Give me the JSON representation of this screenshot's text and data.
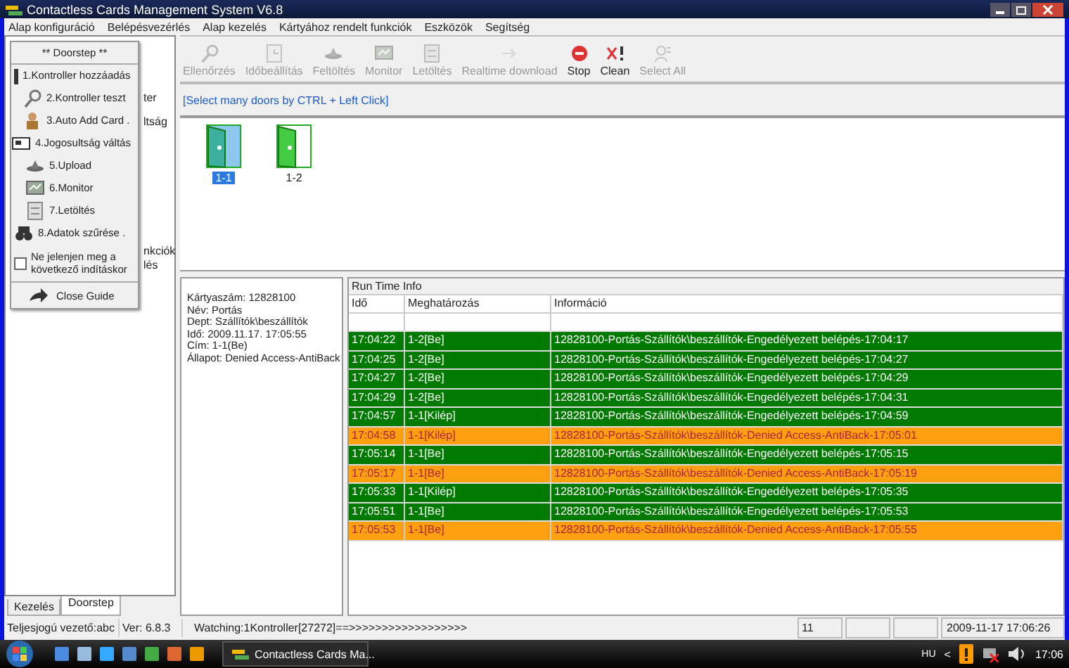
{
  "window": {
    "title": "Contactless Cards Management System  V6.8"
  },
  "menu": [
    "Alap konfiguráció",
    "Belépésvezérlés",
    "Alap kezelés",
    "Kártyához rendelt funkciók",
    "Eszközök",
    "Segítség"
  ],
  "sidebar": {
    "fragments": [
      "ter",
      "ltság",
      "nkciók",
      "lés"
    ],
    "tabs": [
      {
        "label": "Kezelés",
        "selected": false
      },
      {
        "label": "Doorstep",
        "selected": true
      }
    ]
  },
  "guide": {
    "title": "** Doorstep **",
    "items": [
      {
        "label": "1.Kontroller hozzáadás",
        "kind": "add"
      },
      {
        "label": "2.Kontroller teszt",
        "kind": "test"
      },
      {
        "label": "3.Auto Add Card .",
        "kind": "card"
      },
      {
        "label": "4.Jogosultság váltás",
        "kind": "rights"
      },
      {
        "label": "5.Upload",
        "kind": "upload"
      },
      {
        "label": "6.Monitor",
        "kind": "monitor"
      },
      {
        "label": "7.Letöltés",
        "kind": "download"
      },
      {
        "label": "8.Adatok szűrése .",
        "kind": "filter"
      }
    ],
    "dont_show": {
      "label": "Ne jelenjen meg a következő indításkor",
      "checked": false
    },
    "close": "Close Guide"
  },
  "toolbar": [
    {
      "label": "Ellenőrzés",
      "kind": "check",
      "disabled": true
    },
    {
      "label": "Időbeállítás",
      "kind": "time",
      "disabled": true
    },
    {
      "label": "Feltöltés",
      "kind": "upload",
      "disabled": true
    },
    {
      "label": "Monitor",
      "kind": "monitor",
      "disabled": true
    },
    {
      "label": "Letöltés",
      "kind": "download",
      "disabled": true
    },
    {
      "label": "Realtime download",
      "kind": "realtime",
      "disabled": true
    },
    {
      "label": "Stop",
      "kind": "stop",
      "disabled": false
    },
    {
      "label": "Clean",
      "kind": "clean",
      "disabled": false
    },
    {
      "label": "Select All",
      "kind": "selectall",
      "disabled": true
    }
  ],
  "hint": "[Select many doors by CTRL + Left Click]",
  "doors": [
    {
      "label": "1-1",
      "selected": true
    },
    {
      "label": "1-2",
      "selected": false
    }
  ],
  "details": [
    "Kártyaszám: 12828100",
    "Név: Portás",
    "Dept: Szállítók\\beszállítók",
    "Idő: 2009.11.17. 17:05:55",
    "Cím: 1-1(Be)",
    "Állapot: Denied Access-AntiBack"
  ],
  "runtime": {
    "title": "Run Time Info",
    "columns": [
      "Idő",
      "Meghatározás",
      "Információ"
    ],
    "rows": [
      {
        "time": "17:04:22",
        "door": "1-2[Be]",
        "info": "12828100-Portás-Szállítók\\beszállítók-Engedélyezett belépés-17:04:17",
        "kind": "granted"
      },
      {
        "time": "17:04:25",
        "door": "1-2[Be]",
        "info": "12828100-Portás-Szállítók\\beszállítók-Engedélyezett belépés-17:04:27",
        "kind": "granted"
      },
      {
        "time": "17:04:27",
        "door": "1-2[Be]",
        "info": "12828100-Portás-Szállítók\\beszállítók-Engedélyezett belépés-17:04:29",
        "kind": "granted"
      },
      {
        "time": "17:04:29",
        "door": "1-2[Be]",
        "info": "12828100-Portás-Szállítók\\beszállítók-Engedélyezett belépés-17:04:31",
        "kind": "granted"
      },
      {
        "time": "17:04:57",
        "door": "1-1[Kilép]",
        "info": "12828100-Portás-Szállítók\\beszállítók-Engedélyezett belépés-17:04:59",
        "kind": "granted"
      },
      {
        "time": "17:04:58",
        "door": "1-1[Kilép]",
        "info": "12828100-Portás-Szállítók\\beszállítók-Denied Access-AntiBack-17:05:01",
        "kind": "denied"
      },
      {
        "time": "17:05:14",
        "door": "1-1[Be]",
        "info": "12828100-Portás-Szállítók\\beszállítók-Engedélyezett belépés-17:05:15",
        "kind": "granted"
      },
      {
        "time": "17:05:17",
        "door": "1-1[Be]",
        "info": "12828100-Portás-Szállítók\\beszállítók-Denied Access-AntiBack-17:05:19",
        "kind": "denied"
      },
      {
        "time": "17:05:33",
        "door": "1-1[Kilép]",
        "info": "12828100-Portás-Szállítók\\beszállítók-Engedélyezett belépés-17:05:35",
        "kind": "granted"
      },
      {
        "time": "17:05:51",
        "door": "1-1[Be]",
        "info": "12828100-Portás-Szállítók\\beszállítók-Engedélyezett belépés-17:05:53",
        "kind": "granted"
      },
      {
        "time": "17:05:53",
        "door": "1-1[Be]",
        "info": "12828100-Portás-Szállítók\\beszállítók-Denied Access-AntiBack-17:05:55",
        "kind": "denied"
      }
    ]
  },
  "status_bar": [
    "Teljesjogú vezető:abc",
    "Ver: 6.8.3",
    "Watching:1Kontroller[27272]==>>>>>>>>>>>>>>>>>>",
    "11",
    "2009-11-17 17:06:26"
  ],
  "taskbar": {
    "task": "Contactless Cards Ma...",
    "language": "HU",
    "show_hidden": "<",
    "clock": "17:06"
  }
}
